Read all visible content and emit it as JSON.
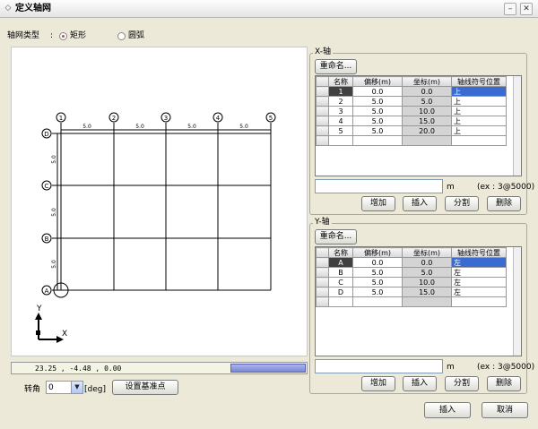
{
  "window": {
    "title": "定义轴网",
    "minimize_glyph": "–",
    "close_glyph": "✕"
  },
  "grid_type": {
    "label": "轴网类型",
    "colon": ":",
    "options": [
      "矩形",
      "圆弧"
    ],
    "selected": "矩形"
  },
  "canvas": {
    "x_axis_labels": [
      "1",
      "2",
      "3",
      "4",
      "5"
    ],
    "y_axis_labels": [
      "D",
      "C",
      "B",
      "A"
    ],
    "x_spacing_labels": [
      "5.0",
      "5.0",
      "5.0",
      "5.0"
    ],
    "y_spacing_labels": [
      "5.0",
      "5.0",
      "5.0"
    ],
    "axis_x_label": "X",
    "axis_y_label": "Y"
  },
  "status": {
    "coords": "23.25 , -4.48 , 0.00"
  },
  "rotation": {
    "label": "转角",
    "value": "0",
    "unit": "[deg]",
    "base_point_button": "设置基准点"
  },
  "x_panel": {
    "title": "X-轴",
    "rename_button": "重命名...",
    "columns": [
      "名称",
      "偏移(m)",
      "坐标(m)",
      "轴线符号位置"
    ],
    "rows": [
      [
        "1",
        "0.0",
        "0.0",
        "上"
      ],
      [
        "2",
        "5.0",
        "5.0",
        "上"
      ],
      [
        "3",
        "5.0",
        "10.0",
        "上"
      ],
      [
        "4",
        "5.0",
        "15.0",
        "上"
      ],
      [
        "5",
        "5.0",
        "20.0",
        "上"
      ]
    ],
    "input_value": "",
    "unit": "m",
    "example": "(ex : 3@5000)",
    "buttons": [
      "增加",
      "插入",
      "分割",
      "删除"
    ]
  },
  "y_panel": {
    "title": "Y-轴",
    "rename_button": "重命名...",
    "columns": [
      "名称",
      "偏移(m)",
      "坐标(m)",
      "轴线符号位置"
    ],
    "rows": [
      [
        "A",
        "0.0",
        "0.0",
        "左"
      ],
      [
        "B",
        "5.0",
        "5.0",
        "左"
      ],
      [
        "C",
        "5.0",
        "10.0",
        "左"
      ],
      [
        "D",
        "5.0",
        "15.0",
        "左"
      ]
    ],
    "input_value": "",
    "unit": "m",
    "example": "(ex : 3@5000)",
    "buttons": [
      "增加",
      "插入",
      "分割",
      "删除"
    ]
  },
  "footer": {
    "insert_button": "插入",
    "cancel_button": "取消"
  }
}
